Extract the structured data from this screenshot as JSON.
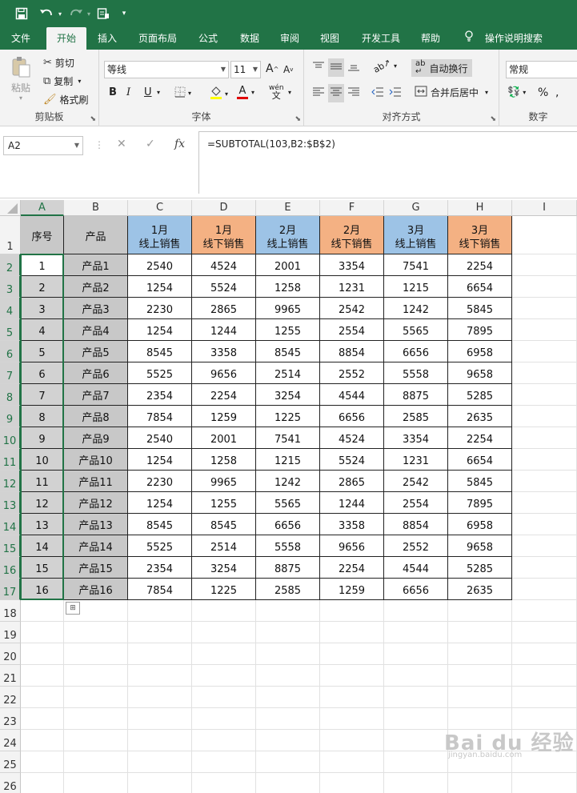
{
  "quick_access": {
    "save_icon": "save-icon",
    "undo_icon": "undo-icon",
    "redo_icon": "redo-icon",
    "form_icon": "form-icon",
    "more_icon": "chevron-down-icon"
  },
  "tabs": [
    {
      "label": "文件"
    },
    {
      "label": "开始",
      "active": true
    },
    {
      "label": "插入"
    },
    {
      "label": "页面布局"
    },
    {
      "label": "公式"
    },
    {
      "label": "数据"
    },
    {
      "label": "审阅"
    },
    {
      "label": "视图"
    },
    {
      "label": "开发工具"
    },
    {
      "label": "帮助"
    }
  ],
  "tell_me": {
    "label": "操作说明搜索",
    "icon": "lightbulb-icon"
  },
  "ribbon": {
    "clipboard": {
      "group_label": "剪贴板",
      "paste": "粘贴",
      "cut": "剪切",
      "copy": "复制",
      "format_painter": "格式刷"
    },
    "font": {
      "group_label": "字体",
      "font_name": "等线",
      "font_size": "11",
      "bold": "B",
      "italic": "I",
      "underline": "U",
      "grow": "A",
      "shrink": "A",
      "font_color": "A"
    },
    "alignment": {
      "group_label": "对齐方式",
      "wrap_text": "自动换行",
      "merge_center": "合并后居中"
    },
    "number": {
      "group_label": "数字",
      "format": "常规",
      "percent": "%"
    }
  },
  "formula_bar": {
    "name_box": "A2",
    "formula": "=SUBTOTAL(103,B2:$B$2)",
    "cancel": "✕",
    "enter": "✓",
    "fx": "fx"
  },
  "sheet": {
    "columns": [
      "A",
      "B",
      "C",
      "D",
      "E",
      "F",
      "G",
      "H",
      "I"
    ],
    "rows": [
      "1",
      "2",
      "3",
      "4",
      "5",
      "6",
      "7",
      "8",
      "9",
      "10",
      "11",
      "12",
      "13",
      "14",
      "15",
      "16",
      "17",
      "18",
      "19",
      "20",
      "21",
      "22",
      "23",
      "24",
      "25",
      "26"
    ],
    "header_row": [
      [
        "序号"
      ],
      [
        "产品"
      ],
      [
        "1月",
        "线上销售"
      ],
      [
        "1月",
        "线下销售"
      ],
      [
        "2月",
        "线上销售"
      ],
      [
        "2月",
        "线下销售"
      ],
      [
        "3月",
        "线上销售"
      ],
      [
        "3月",
        "线下销售"
      ]
    ],
    "header_colors": {
      "gray": "#c8c8c8",
      "blue": "#9dc3e6",
      "orange": "#f4b183"
    },
    "data": [
      [
        "1",
        "产品1",
        "2540",
        "4524",
        "2001",
        "3354",
        "7541",
        "2254"
      ],
      [
        "2",
        "产品2",
        "1254",
        "5524",
        "1258",
        "1231",
        "1215",
        "6654"
      ],
      [
        "3",
        "产品3",
        "2230",
        "2865",
        "9965",
        "2542",
        "1242",
        "5845"
      ],
      [
        "4",
        "产品4",
        "1254",
        "1244",
        "1255",
        "2554",
        "5565",
        "7895"
      ],
      [
        "5",
        "产品5",
        "8545",
        "3358",
        "8545",
        "8854",
        "6656",
        "6958"
      ],
      [
        "6",
        "产品6",
        "5525",
        "9656",
        "2514",
        "2552",
        "5558",
        "9658"
      ],
      [
        "7",
        "产品7",
        "2354",
        "2254",
        "3254",
        "4544",
        "8875",
        "5285"
      ],
      [
        "8",
        "产品8",
        "7854",
        "1259",
        "1225",
        "6656",
        "2585",
        "2635"
      ],
      [
        "9",
        "产品9",
        "2540",
        "2001",
        "7541",
        "4524",
        "3354",
        "2254"
      ],
      [
        "10",
        "产品10",
        "1254",
        "1258",
        "1215",
        "5524",
        "1231",
        "6654"
      ],
      [
        "11",
        "产品11",
        "2230",
        "9965",
        "1242",
        "2865",
        "2542",
        "5845"
      ],
      [
        "12",
        "产品12",
        "1254",
        "1255",
        "5565",
        "1244",
        "2554",
        "7895"
      ],
      [
        "13",
        "产品13",
        "8545",
        "8545",
        "6656",
        "3358",
        "8854",
        "6958"
      ],
      [
        "14",
        "产品14",
        "5525",
        "2514",
        "5558",
        "9656",
        "2552",
        "9658"
      ],
      [
        "15",
        "产品15",
        "2354",
        "3254",
        "8875",
        "2254",
        "4544",
        "5285"
      ],
      [
        "16",
        "产品16",
        "7854",
        "1225",
        "2585",
        "1259",
        "6656",
        "2635"
      ]
    ],
    "selected_range": "A2:A17",
    "accent": "#217346"
  },
  "watermark": {
    "main": "Bai du 经验",
    "sub": "jingyan.baidu.com"
  }
}
